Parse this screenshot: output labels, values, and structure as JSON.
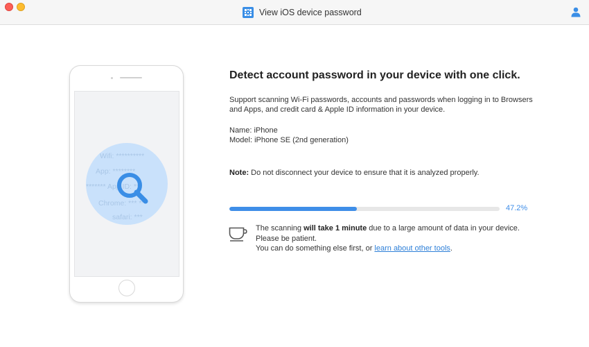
{
  "window": {
    "title": "View iOS device password",
    "icons": {
      "app": "grid-app-icon",
      "user": "user-icon",
      "close": "close-icon",
      "minimize": "minimize-icon"
    }
  },
  "illustration": {
    "credentials": [
      "Wifi: **********",
      "App: ********",
      "******* App ID: **",
      "Chrome: *** ***",
      "safari: ***"
    ],
    "icon": "magnifier-icon"
  },
  "main": {
    "heading": "Detect account password in your device with one click.",
    "description": "Support scanning Wi-Fi passwords, accounts and passwords when logging in to Browsers and Apps, and credit card & Apple ID information in your device.",
    "device_name_label": "Name:",
    "device_name": "iPhone",
    "device_model_label": "Model:",
    "device_model": "iPhone SE (2nd generation)",
    "note_label": "Note:",
    "note_text": "Do not disconnect your device to ensure that it is analyzed properly."
  },
  "progress": {
    "value": 47.2,
    "label": "47.2%",
    "fill_color": "#3f8ee8"
  },
  "tip": {
    "icon": "cup-icon",
    "line1_pre": "The scanning",
    "line1_bold": "will take 1 minute",
    "line1_post": "due to a large amount of data in your device. Please be patient.",
    "line2_pre": "You can do something else first, or",
    "link_text": "learn about other tools",
    "line2_post": "."
  }
}
